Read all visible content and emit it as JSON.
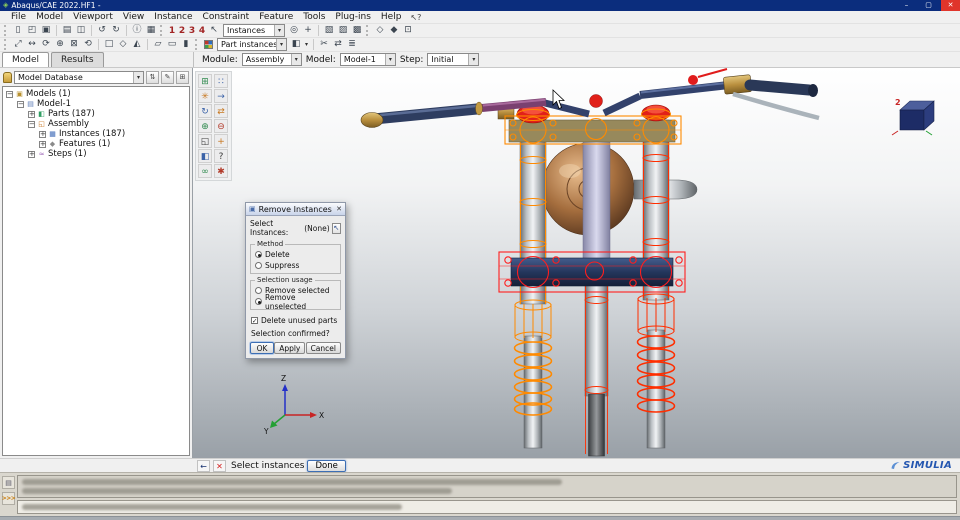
{
  "window": {
    "title": "Abaqus/CAE 2022.HF1 -"
  },
  "menu": {
    "items": [
      "File",
      "Model",
      "Viewport",
      "View",
      "Instance",
      "Constraint",
      "Feature",
      "Tools",
      "Plug-ins",
      "Help"
    ],
    "context_help": "↖?"
  },
  "toolbars": {
    "instances_combo": "Instances",
    "part_instances_combo": "Part instances",
    "viewport_numbers": [
      "1",
      "2",
      "3",
      "4"
    ]
  },
  "context_bar": {
    "module_label": "Module:",
    "module_value": "Assembly",
    "model_label": "Model:",
    "model_value": "Model-1",
    "step_label": "Step:",
    "step_value": "Initial"
  },
  "sidebar": {
    "tabs": [
      {
        "label": "Model",
        "active": true
      },
      {
        "label": "Results",
        "active": false
      }
    ],
    "database_combo": "Model Database",
    "tree": [
      {
        "label": "Models (1)"
      },
      {
        "label": "Model-1"
      },
      {
        "label": "Parts (187)"
      },
      {
        "label": "Assembly"
      },
      {
        "label": "Instances (187)"
      },
      {
        "label": "Features (1)"
      },
      {
        "label": "Steps (1)"
      }
    ]
  },
  "dialog": {
    "title": "Remove Instances",
    "select_label": "Select Instances:",
    "select_value": "(None)",
    "method_group": "Method",
    "method_options": [
      {
        "label": "Delete",
        "selected": true
      },
      {
        "label": "Suppress",
        "selected": false
      }
    ],
    "usage_group": "Selection usage",
    "usage_options": [
      {
        "label": "Remove selected",
        "selected": false
      },
      {
        "label": "Remove unselected",
        "selected": true
      }
    ],
    "delete_unused": {
      "label": "Delete unused parts",
      "checked": true
    },
    "confirm_text": "Selection confirmed?",
    "ok": "OK",
    "apply": "Apply",
    "cancel": "Cancel"
  },
  "prompt": {
    "text": "Select instances",
    "done": "Done"
  },
  "brand": {
    "name": "SIMULIA"
  },
  "viewport": {
    "triad": {
      "x": "X",
      "y": "Y",
      "z": "Z"
    },
    "view_cube_label": "2"
  },
  "colors": {
    "titlebar": "#0b2d7d",
    "highlight_orange": "#ff8a00",
    "highlight_red": "#ff1e1e",
    "accent_blue": "#2456b0"
  },
  "icons": {
    "app": "◈",
    "minimize": "–",
    "maximize": "▢",
    "close": "✕",
    "dropdown": "▾",
    "expand_minus": "−",
    "expand_plus": "+",
    "checkmark": "✓",
    "new_model": "▯",
    "open_database": "◰",
    "save_database": "▣",
    "print": "▤",
    "capture_view": "◫",
    "undo": "↺",
    "redo": "↻",
    "query_info": "ⓘ",
    "manager": "▦",
    "selection_pointer": "↖",
    "search": "◎",
    "probe_values": "+",
    "display_group_create": "▧",
    "display_group_remove": "▨",
    "display_group_replace": "▩",
    "views_toolbox": "◇",
    "render_options": "◆",
    "lock_viewport": "⊡",
    "fit_view": "⤢",
    "pan_view": "↔",
    "rotate_view": "⟳",
    "zoom_view": "⊕",
    "box_zoom": "⊠",
    "cycle_views": "⟲",
    "front_view": "□",
    "iso_view": "◇",
    "perspective": "◭",
    "wireframe_render": "▱",
    "hiddenline_render": "▭",
    "shaded_render": "▮",
    "color_fill": "◧",
    "view_cut": "✂",
    "sync_viewports": "⇄",
    "options_menu": "≣",
    "tree_sort": "⇅",
    "tree_edit": "✎",
    "tree_pin": "⊞",
    "back_arrow": "←",
    "cancel_x": "✕",
    "message_tab": "▤",
    "kernel_prompt": ">>>",
    "pick_in_viewport": "↖",
    "dialog_badge": "▣",
    "tree_models": "▣",
    "tree_model": "▤",
    "tree_parts": "◧",
    "tree_assembly": "◱",
    "tree_instances": "▦",
    "tree_features": "◆",
    "tree_steps": "≈",
    "tbx_create_instance": "⊞",
    "tbx_linear_pattern": "∷",
    "tbx_radial_pattern": "✳",
    "tbx_translate": "→",
    "tbx_rotate": "↻",
    "tbx_replace": "⇄",
    "tbx_merge": "⊕",
    "tbx_cut": "⊖",
    "tbx_bbox": "◱",
    "tbx_datum": "+",
    "tbx_partition": "◧",
    "tbx_query": "?",
    "tbx_attach": "∞",
    "tbx_tools": "✱"
  }
}
